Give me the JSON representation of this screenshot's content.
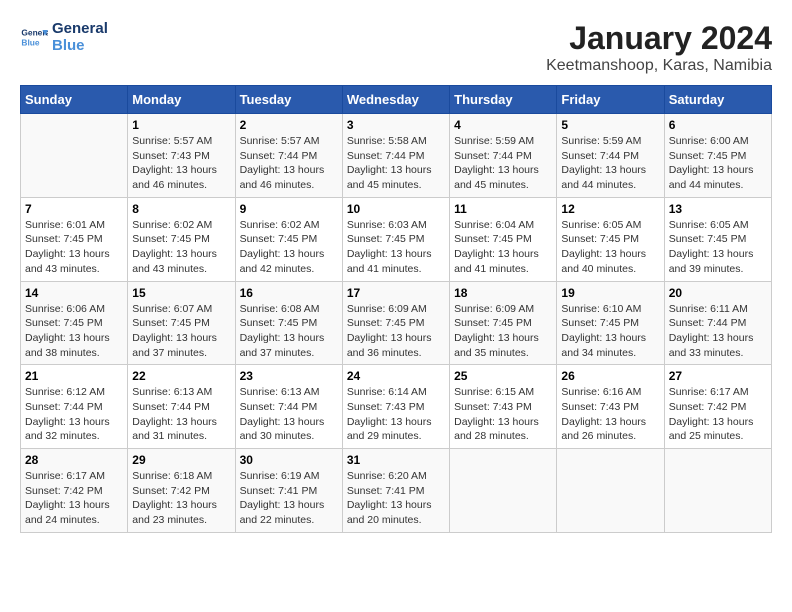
{
  "header": {
    "logo_line1": "General",
    "logo_line2": "Blue",
    "title": "January 2024",
    "subtitle": "Keetmanshoop, Karas, Namibia"
  },
  "days_of_week": [
    "Sunday",
    "Monday",
    "Tuesday",
    "Wednesday",
    "Thursday",
    "Friday",
    "Saturday"
  ],
  "weeks": [
    [
      {
        "num": "",
        "info": ""
      },
      {
        "num": "1",
        "info": "Sunrise: 5:57 AM\nSunset: 7:43 PM\nDaylight: 13 hours\nand 46 minutes."
      },
      {
        "num": "2",
        "info": "Sunrise: 5:57 AM\nSunset: 7:44 PM\nDaylight: 13 hours\nand 46 minutes."
      },
      {
        "num": "3",
        "info": "Sunrise: 5:58 AM\nSunset: 7:44 PM\nDaylight: 13 hours\nand 45 minutes."
      },
      {
        "num": "4",
        "info": "Sunrise: 5:59 AM\nSunset: 7:44 PM\nDaylight: 13 hours\nand 45 minutes."
      },
      {
        "num": "5",
        "info": "Sunrise: 5:59 AM\nSunset: 7:44 PM\nDaylight: 13 hours\nand 44 minutes."
      },
      {
        "num": "6",
        "info": "Sunrise: 6:00 AM\nSunset: 7:45 PM\nDaylight: 13 hours\nand 44 minutes."
      }
    ],
    [
      {
        "num": "7",
        "info": "Sunrise: 6:01 AM\nSunset: 7:45 PM\nDaylight: 13 hours\nand 43 minutes."
      },
      {
        "num": "8",
        "info": "Sunrise: 6:02 AM\nSunset: 7:45 PM\nDaylight: 13 hours\nand 43 minutes."
      },
      {
        "num": "9",
        "info": "Sunrise: 6:02 AM\nSunset: 7:45 PM\nDaylight: 13 hours\nand 42 minutes."
      },
      {
        "num": "10",
        "info": "Sunrise: 6:03 AM\nSunset: 7:45 PM\nDaylight: 13 hours\nand 41 minutes."
      },
      {
        "num": "11",
        "info": "Sunrise: 6:04 AM\nSunset: 7:45 PM\nDaylight: 13 hours\nand 41 minutes."
      },
      {
        "num": "12",
        "info": "Sunrise: 6:05 AM\nSunset: 7:45 PM\nDaylight: 13 hours\nand 40 minutes."
      },
      {
        "num": "13",
        "info": "Sunrise: 6:05 AM\nSunset: 7:45 PM\nDaylight: 13 hours\nand 39 minutes."
      }
    ],
    [
      {
        "num": "14",
        "info": "Sunrise: 6:06 AM\nSunset: 7:45 PM\nDaylight: 13 hours\nand 38 minutes."
      },
      {
        "num": "15",
        "info": "Sunrise: 6:07 AM\nSunset: 7:45 PM\nDaylight: 13 hours\nand 37 minutes."
      },
      {
        "num": "16",
        "info": "Sunrise: 6:08 AM\nSunset: 7:45 PM\nDaylight: 13 hours\nand 37 minutes."
      },
      {
        "num": "17",
        "info": "Sunrise: 6:09 AM\nSunset: 7:45 PM\nDaylight: 13 hours\nand 36 minutes."
      },
      {
        "num": "18",
        "info": "Sunrise: 6:09 AM\nSunset: 7:45 PM\nDaylight: 13 hours\nand 35 minutes."
      },
      {
        "num": "19",
        "info": "Sunrise: 6:10 AM\nSunset: 7:45 PM\nDaylight: 13 hours\nand 34 minutes."
      },
      {
        "num": "20",
        "info": "Sunrise: 6:11 AM\nSunset: 7:44 PM\nDaylight: 13 hours\nand 33 minutes."
      }
    ],
    [
      {
        "num": "21",
        "info": "Sunrise: 6:12 AM\nSunset: 7:44 PM\nDaylight: 13 hours\nand 32 minutes."
      },
      {
        "num": "22",
        "info": "Sunrise: 6:13 AM\nSunset: 7:44 PM\nDaylight: 13 hours\nand 31 minutes."
      },
      {
        "num": "23",
        "info": "Sunrise: 6:13 AM\nSunset: 7:44 PM\nDaylight: 13 hours\nand 30 minutes."
      },
      {
        "num": "24",
        "info": "Sunrise: 6:14 AM\nSunset: 7:43 PM\nDaylight: 13 hours\nand 29 minutes."
      },
      {
        "num": "25",
        "info": "Sunrise: 6:15 AM\nSunset: 7:43 PM\nDaylight: 13 hours\nand 28 minutes."
      },
      {
        "num": "26",
        "info": "Sunrise: 6:16 AM\nSunset: 7:43 PM\nDaylight: 13 hours\nand 26 minutes."
      },
      {
        "num": "27",
        "info": "Sunrise: 6:17 AM\nSunset: 7:42 PM\nDaylight: 13 hours\nand 25 minutes."
      }
    ],
    [
      {
        "num": "28",
        "info": "Sunrise: 6:17 AM\nSunset: 7:42 PM\nDaylight: 13 hours\nand 24 minutes."
      },
      {
        "num": "29",
        "info": "Sunrise: 6:18 AM\nSunset: 7:42 PM\nDaylight: 13 hours\nand 23 minutes."
      },
      {
        "num": "30",
        "info": "Sunrise: 6:19 AM\nSunset: 7:41 PM\nDaylight: 13 hours\nand 22 minutes."
      },
      {
        "num": "31",
        "info": "Sunrise: 6:20 AM\nSunset: 7:41 PM\nDaylight: 13 hours\nand 20 minutes."
      },
      {
        "num": "",
        "info": ""
      },
      {
        "num": "",
        "info": ""
      },
      {
        "num": "",
        "info": ""
      }
    ]
  ]
}
